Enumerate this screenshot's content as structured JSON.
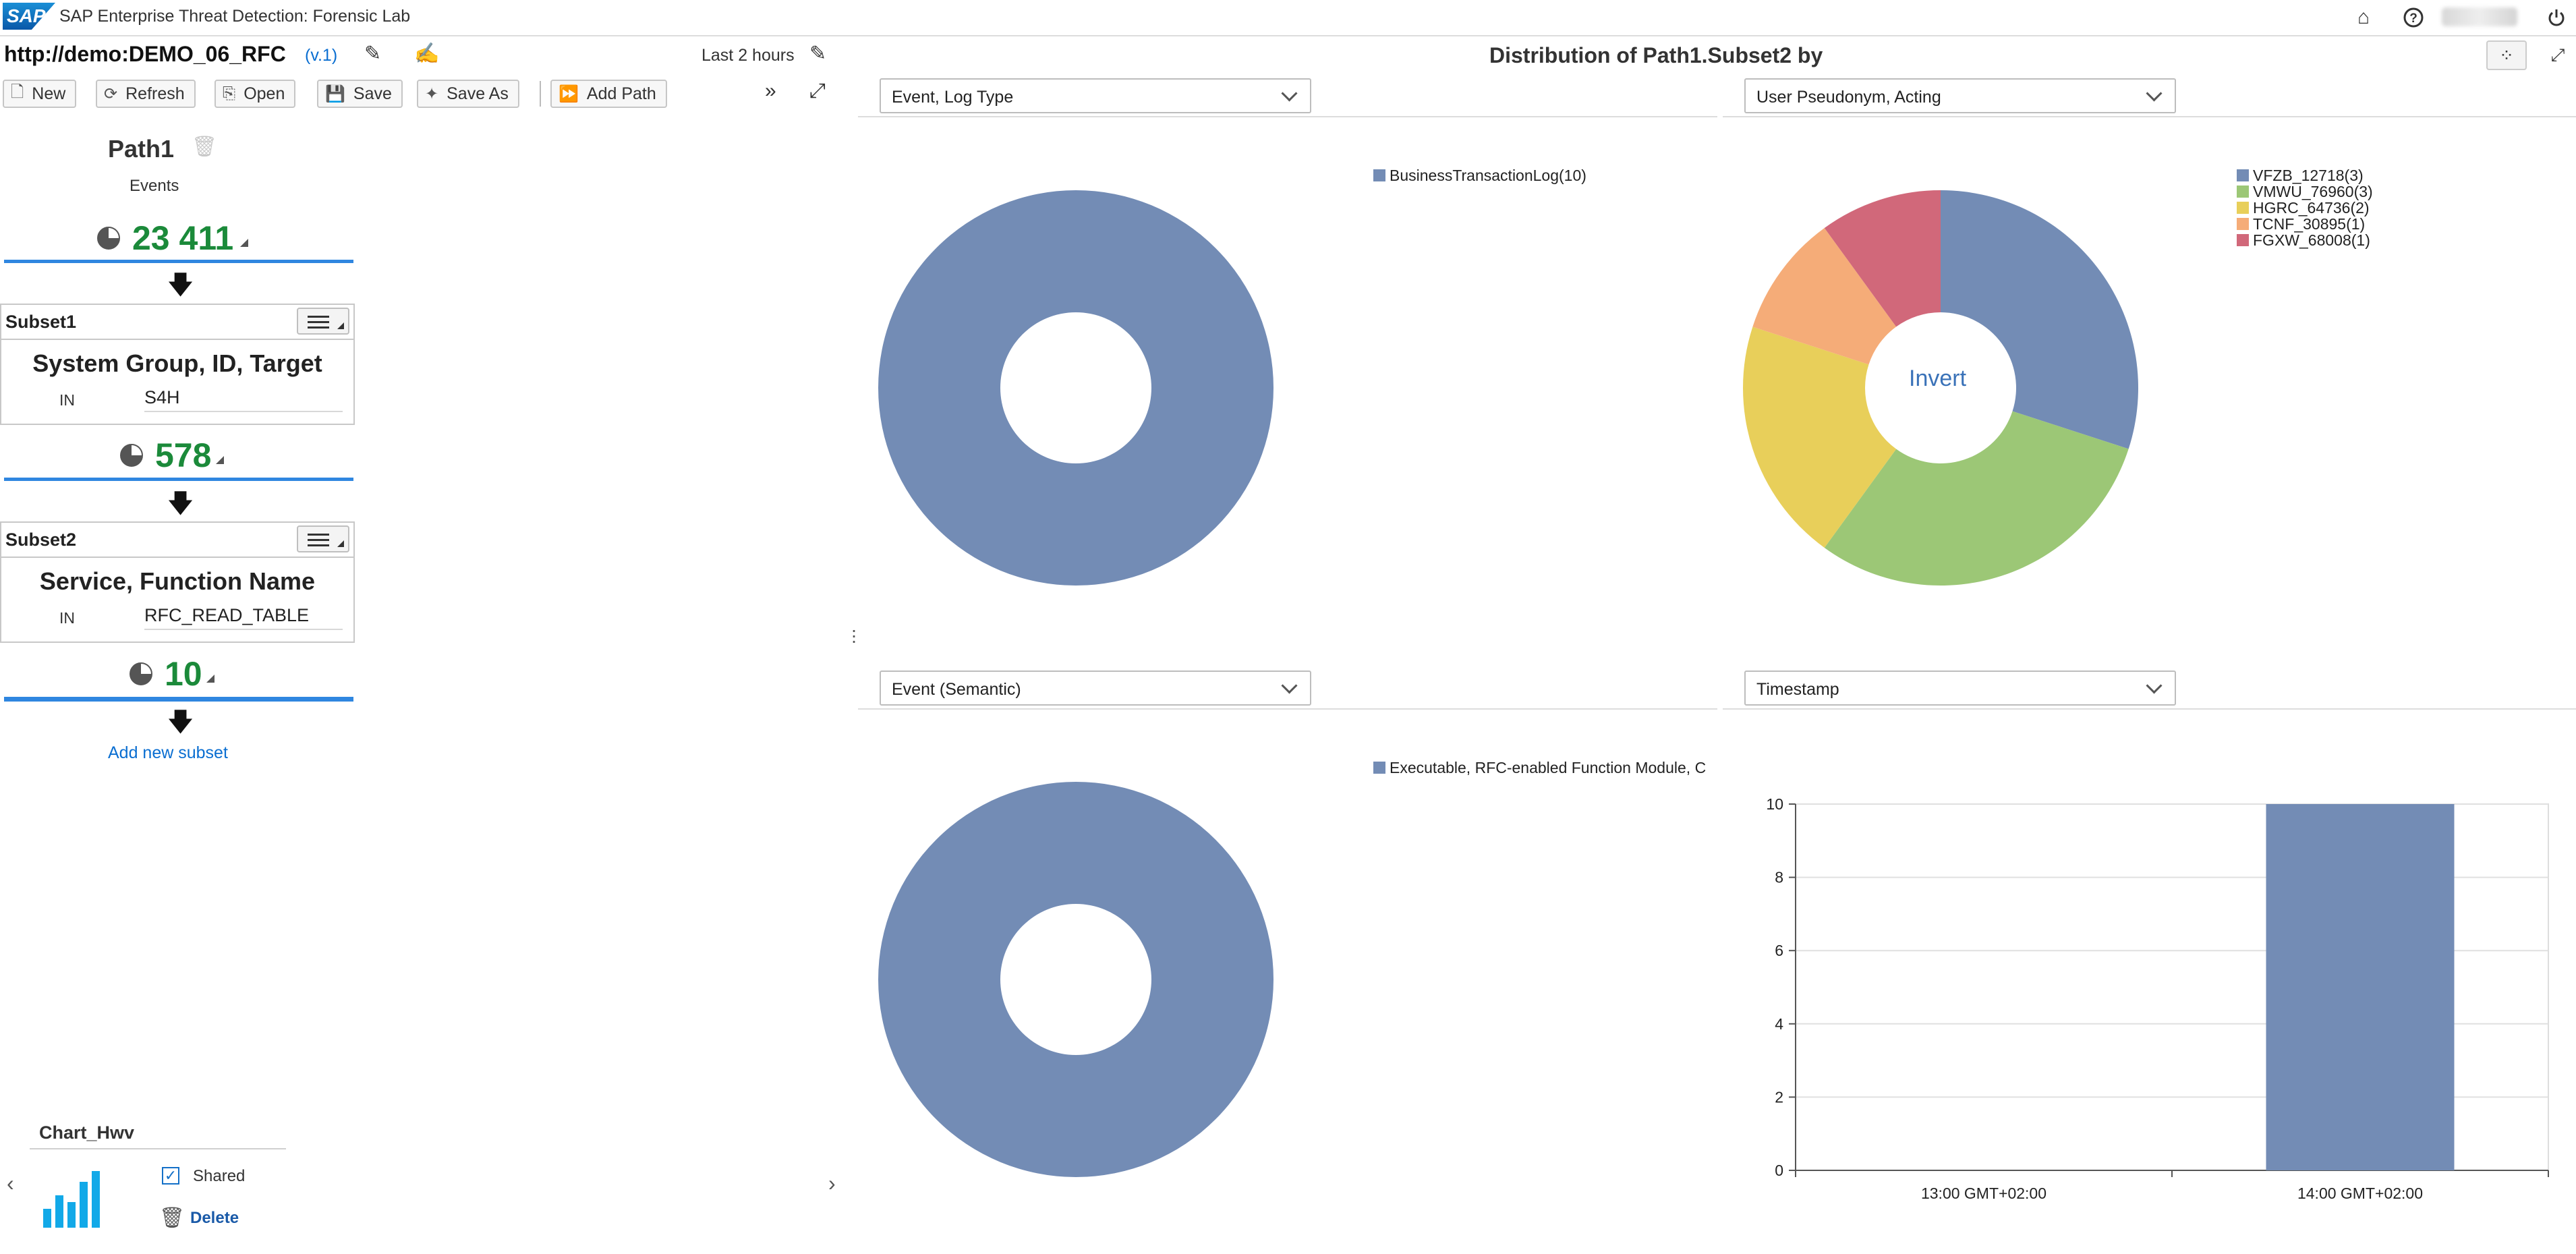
{
  "shell": {
    "logo_text": "SAP",
    "title": "SAP Enterprise Threat Detection: Forensic Lab",
    "icons": [
      "home-icon",
      "help-icon",
      "power-icon"
    ]
  },
  "path_header": {
    "url": "http://demo:DEMO_06_RFC",
    "version": "(v.1)",
    "time_range": "Last 2 hours"
  },
  "toolbar": {
    "new": "New",
    "refresh": "Refresh",
    "open": "Open",
    "save": "Save",
    "save_as": "Save As",
    "add_path": "Add Path"
  },
  "path": {
    "name": "Path1",
    "events_label": "Events",
    "event_count": "23 411",
    "subsets": [
      {
        "name": "Subset1",
        "attribute": "System Group, ID, Target",
        "operator": "IN",
        "value": "S4H",
        "count": "578"
      },
      {
        "name": "Subset2",
        "attribute": "Service, Function Name",
        "operator": "IN",
        "value": "RFC_READ_TABLE",
        "count": "10"
      }
    ],
    "add_subset": "Add new subset"
  },
  "saved_chart": {
    "title": "Chart_Hwv",
    "shared_label": "Shared",
    "shared": true,
    "delete_label": "Delete"
  },
  "distribution": {
    "title": "Distribution of Path1.Subset2 by",
    "invert_label": "Invert"
  },
  "chart_data": [
    {
      "type": "pie",
      "dropdown": "Event, Log Type",
      "donut": true,
      "slices": [
        {
          "label": "BusinessTransactionLog(10)",
          "value": 10,
          "color": "#738cb5"
        }
      ]
    },
    {
      "type": "pie",
      "dropdown": "User Pseudonym, Acting",
      "donut": true,
      "slices": [
        {
          "label": "VFZB_12718(3)",
          "value": 3,
          "color": "#738cb5"
        },
        {
          "label": "VMWU_76960(3)",
          "value": 3,
          "color": "#9cc776"
        },
        {
          "label": "HGRC_64736(2)",
          "value": 2,
          "color": "#e8cf5a"
        },
        {
          "label": "TCNF_30895(1)",
          "value": 1,
          "color": "#f5ac78"
        },
        {
          "label": "FGXW_68008(1)",
          "value": 1,
          "color": "#d1687a"
        }
      ]
    },
    {
      "type": "pie",
      "dropdown": "Event (Semantic)",
      "donut": true,
      "slices": [
        {
          "label": "Executable, RFC-enabled Function Module, C",
          "value": 10,
          "color": "#738cb5"
        }
      ]
    },
    {
      "type": "bar",
      "dropdown": "Timestamp",
      "categories": [
        "13:00 GMT+02:00",
        "14:00 GMT+02:00"
      ],
      "values": [
        0,
        10
      ],
      "yticks": [
        "0",
        "2",
        "4",
        "6",
        "8",
        "10"
      ],
      "ylim": [
        0,
        10
      ],
      "color": "#738cb5",
      "grid": true
    }
  ]
}
